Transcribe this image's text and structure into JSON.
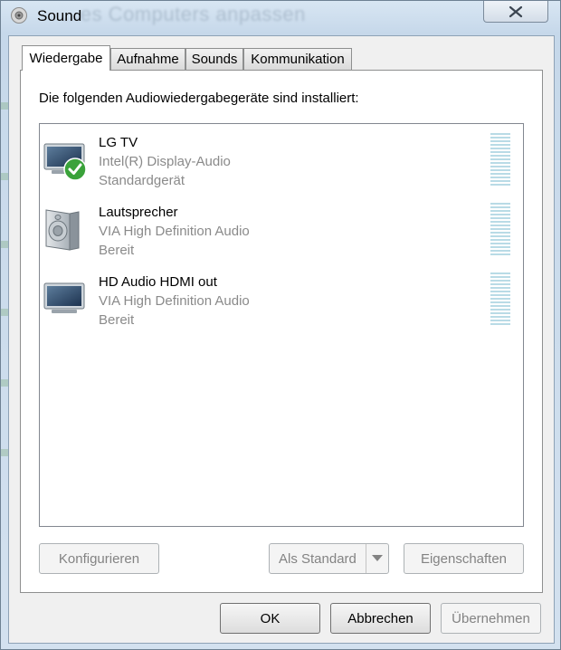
{
  "window": {
    "title": "Sound",
    "background_title": "...es Computers anpassen",
    "close_icon": "close-icon"
  },
  "tabs": [
    {
      "label": "Wiedergabe",
      "active": true
    },
    {
      "label": "Aufnahme",
      "active": false
    },
    {
      "label": "Sounds",
      "active": false
    },
    {
      "label": "Kommunikation",
      "active": false
    }
  ],
  "panel": {
    "label": "Die folgenden Audiowiedergabegeräte sind installiert:"
  },
  "devices": [
    {
      "name": "LG TV",
      "driver": "Intel(R) Display-Audio",
      "status": "Standardgerät",
      "icon": "monitor-icon",
      "default": true
    },
    {
      "name": "Lautsprecher",
      "driver": "VIA High Definition Audio",
      "status": "Bereit",
      "icon": "speaker-icon",
      "default": false
    },
    {
      "name": "HD Audio HDMI out",
      "driver": "VIA High Definition Audio",
      "status": "Bereit",
      "icon": "monitor-icon",
      "default": false
    }
  ],
  "panel_buttons": {
    "configure": "Konfigurieren",
    "set_default": "Als Standard",
    "properties": "Eigenschaften"
  },
  "dialog_buttons": {
    "ok": "OK",
    "cancel": "Abbrechen",
    "apply": "Übernehmen"
  },
  "colors": {
    "meter": "#b9dbe6",
    "disabled_text": "#838383",
    "secondary_text": "#8a8a8a"
  }
}
